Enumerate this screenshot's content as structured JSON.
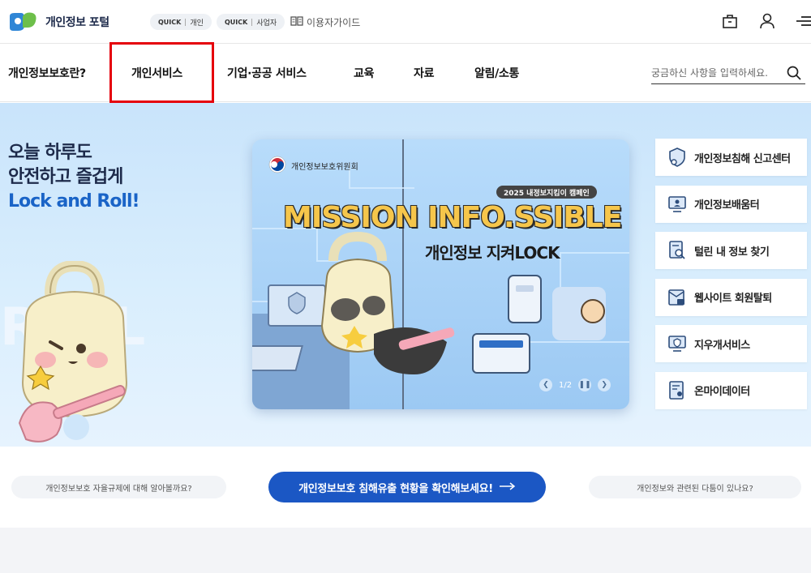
{
  "header": {
    "logo_text": "개인정보 포털",
    "quick": [
      {
        "tag": "QUICK",
        "label": "개인"
      },
      {
        "tag": "QUICK",
        "label": "사업자"
      }
    ],
    "guide_label": "이용자가이드",
    "icons": [
      "bag-icon",
      "user-icon",
      "menu-icon"
    ]
  },
  "nav": {
    "items": [
      "개인정보보호란?",
      "개인서비스",
      "기업·공공 서비스",
      "교육",
      "자료",
      "알림/소통"
    ],
    "highlighted": "개인서비스",
    "search_placeholder": "궁금하신 사항을 입력하세요.",
    "highlight_color": "#e5000b"
  },
  "hero": {
    "line1": "오늘 하루도",
    "line2": "안전하고 즐겁게",
    "line3": "Lock and Roll!",
    "roll_watermark": "ROLL",
    "banner": {
      "org": "개인정보보호위원회",
      "campaign": "2025 내정보지킴이 캠페인",
      "title": "MISSION INFO.SSIBLE",
      "subtitle": "개인정보 지켜LOCK",
      "page": "1/2"
    },
    "quick_links": [
      {
        "label": "개인정보침해 신고센터",
        "icon": "shield-user-icon"
      },
      {
        "label": "개인정보배움터",
        "icon": "monitor-user-icon"
      },
      {
        "label": "털린 내 정보 찾기",
        "icon": "doc-search-icon"
      },
      {
        "label": "웹사이트 회원탈퇴",
        "icon": "mail-lock-icon"
      },
      {
        "label": "지우개서비스",
        "icon": "monitor-shield-icon"
      },
      {
        "label": "온마이데이터",
        "icon": "doc-user-icon"
      }
    ]
  },
  "strip": {
    "left": "개인정보보호 자율규제에 대해 알아볼까요?",
    "cta": "개인정보보호 침해유출 현황을 확인해보세요!",
    "right": "개인정보와 관련된 다툼이 있나요?"
  },
  "colors": {
    "brand_blue": "#1b57c4",
    "accent_blue": "#1a64c7",
    "navy": "#1d2a4a"
  }
}
